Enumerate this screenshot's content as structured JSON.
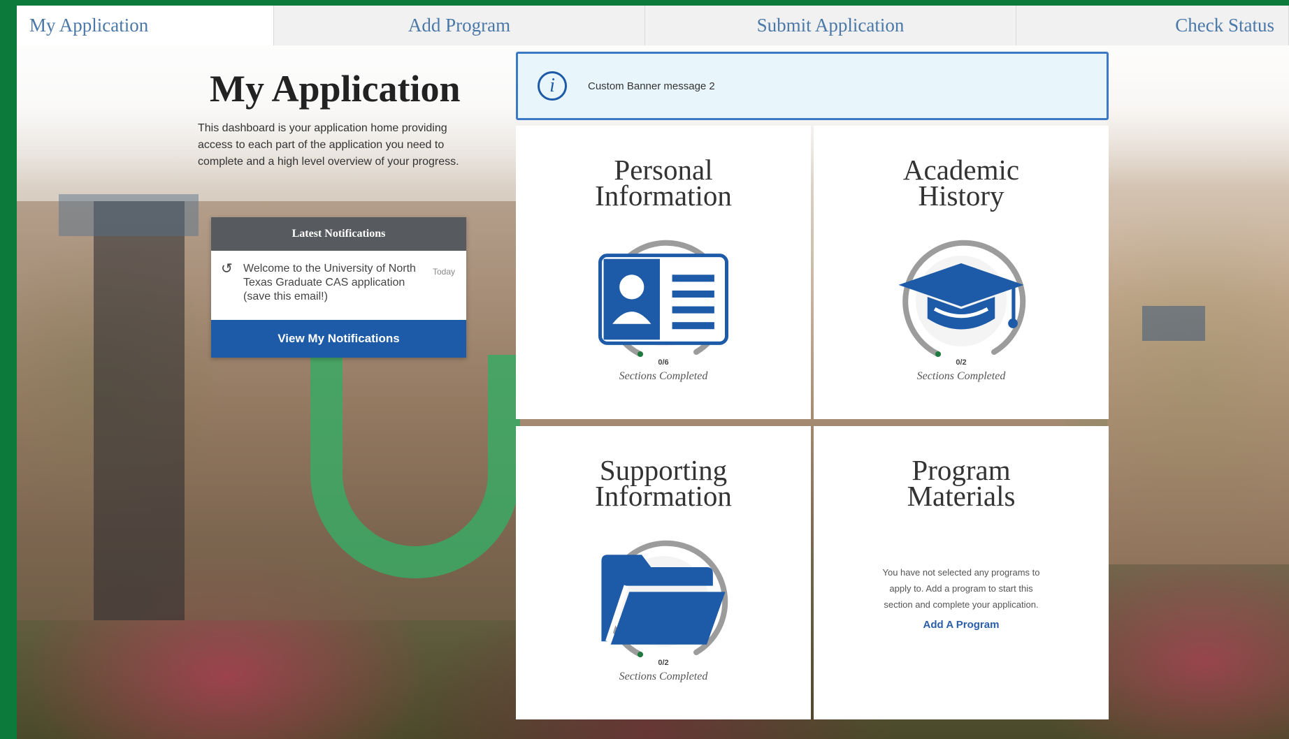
{
  "nav": {
    "tabs": [
      {
        "label": "My Application"
      },
      {
        "label": "Add Program"
      },
      {
        "label": "Submit Application"
      },
      {
        "label": "Check Status"
      }
    ]
  },
  "intro": {
    "title": "My Application",
    "description": "This dashboard is your application home providing access to each part of the application you need to complete and a high level overview of your progress."
  },
  "notifications": {
    "header": "Latest Notifications",
    "items": [
      {
        "text": "Welcome to the University of North Texas Graduate CAS application (save this email!)",
        "date": "Today"
      }
    ],
    "button_label": "View My Notifications"
  },
  "banner": {
    "message": "Custom Banner message 2"
  },
  "cards": [
    {
      "title_line1": "Personal",
      "title_line2": "Information",
      "count": "0/6",
      "sections_label": "Sections Completed",
      "icon": "id-card-icon"
    },
    {
      "title_line1": "Academic",
      "title_line2": "History",
      "count": "0/2",
      "sections_label": "Sections Completed",
      "icon": "graduation-cap-icon"
    },
    {
      "title_line1": "Supporting",
      "title_line2": "Information",
      "count": "0/2",
      "sections_label": "Sections Completed",
      "icon": "folder-icon"
    },
    {
      "title_line1": "Program",
      "title_line2": "Materials",
      "message": "You have not selected any programs to apply to. Add a program to start this section and complete your application.",
      "link_label": "Add A Program"
    }
  ],
  "colors": {
    "frame_green": "#0b7a3a",
    "accent_blue": "#1d5aa8",
    "banner_bg": "#e8f6fb",
    "banner_border": "#3b79c4"
  }
}
